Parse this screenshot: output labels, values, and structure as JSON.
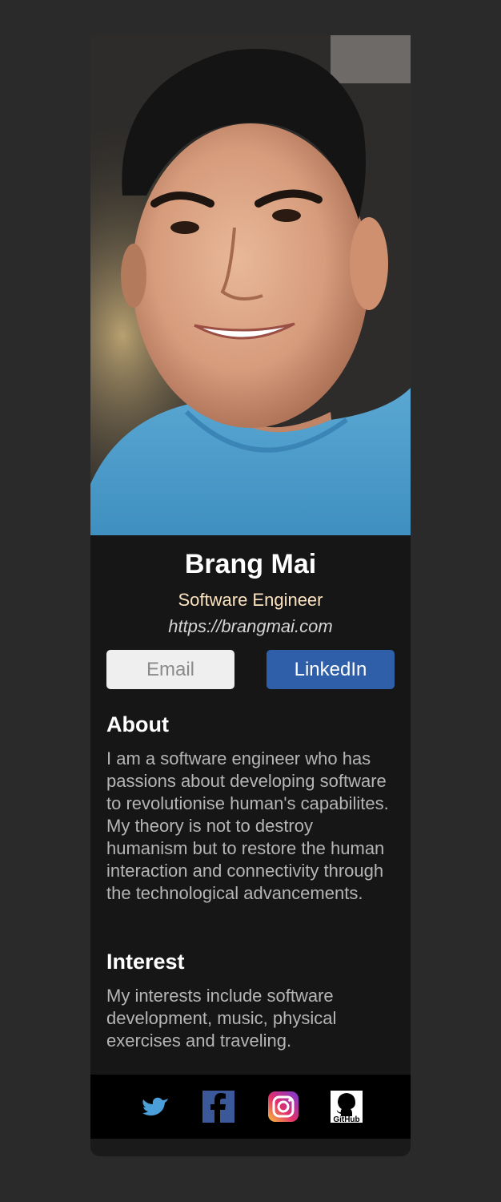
{
  "profile": {
    "photo_alt": "portrait-photo",
    "name": "Brang Mai",
    "title": "Software Engineer",
    "website": "https://brangmai.com"
  },
  "buttons": {
    "email_label": "Email",
    "linkedin_label": "LinkedIn"
  },
  "about": {
    "heading": "About",
    "text": "I am a software engineer who has passions about developing software to revolutionise human's capabilites. My theory is not to destroy humanism but to restore the human interaction and connectivity through the technological advancements."
  },
  "interest": {
    "heading": "Interest",
    "text": "My interests include software development, music, physical exercises and traveling."
  },
  "social": {
    "items": [
      {
        "icon": "twitter-icon",
        "color": "#4a9fd8"
      },
      {
        "icon": "facebook-icon",
        "color": "#3b5998"
      },
      {
        "icon": "instagram-icon",
        "color": "#e1306c"
      },
      {
        "icon": "github-icon",
        "color": "#ffffff",
        "label": "GitHub"
      }
    ]
  },
  "colors": {
    "page_bg": "#2a2a2a",
    "card_bg": "#161616",
    "accent_title": "#fbe3c0",
    "linkedin_blue": "#2f5fa9",
    "footer_bg": "#000000"
  }
}
